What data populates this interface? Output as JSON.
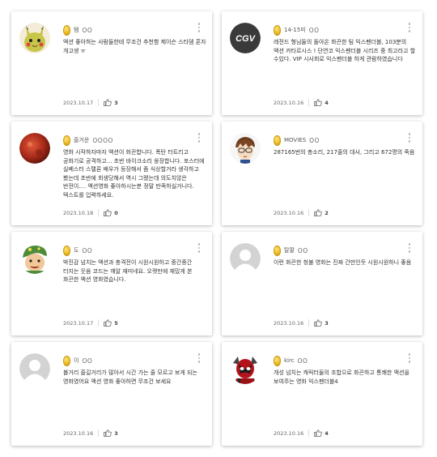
{
  "comments": [
    {
      "nickname": "탬",
      "masked": "OO",
      "text": "액션 좋아하는 사람들한테 무조건 추천함 제이슨 스타뎀 혼자 개고생 ㅠ",
      "date": "2023.10.17",
      "likes": "3",
      "avatar": "pikachu-avatar"
    },
    {
      "nickname": "14-15미",
      "masked": "OO",
      "text": "레전드 형님들의 돌아온 화끈한 팀 익스펜더블, 103분의 액션 카타르시스 ! 단연코 익스펜더블 시리즈 중 최고라고 할 수있다. VIP 시사회로 익스펜더블 하게 관람하였습니다",
      "date": "2023.10.16",
      "likes": "4",
      "avatar": "cgv-logo-avatar"
    },
    {
      "nickname": "즐거운",
      "masked": "OOOO",
      "text": "영화 시작하자마자 액션이 화끈합니다. 폭탄 터트리고 공화기로 공격하고... 초반 바이크소리 웅장합니다. 포스터에 실베스터 스탤론 배우가 등장해서 좀 식상할거라 생각하고 봤는데 초반에 회생당해서 역시 그랬는데 의도치않은 반전이.... 액션영화 좋아하시는분 정말 만족하실거니다.                    텍스트를 입력하세요.",
      "date": "2023.10.18",
      "likes": "0",
      "avatar": "red-sphere-avatar"
    },
    {
      "nickname": "MOVIES",
      "masked": "OO",
      "text": "287165번의 총소리, 217줄의 대사, 그리고 672명의 죽음",
      "date": "2023.10.16",
      "likes": "2",
      "avatar": "anime-character-avatar"
    },
    {
      "nickname": "도",
      "masked": "OO",
      "text": "박진감 넘치는 액션과 충격전이 시원시원하고 중간중간 터지는 웃음 코드는 깨알 재미네요. 오랫만에 재밌게 본 화끈한 액션 영화였습니다.",
      "date": "2023.10.17",
      "likes": "5",
      "avatar": "green-cap-character-avatar"
    },
    {
      "nickname": "탈팔",
      "masked": "OO",
      "text": "이런 화끈한 청불 영화는 진짜 간만인듯 시원시원하니 좋음",
      "date": "2023.10.16",
      "likes": "3",
      "avatar": "default-user-avatar"
    },
    {
      "nickname": "이",
      "masked": "OO",
      "text": "볼거리 즐길거리가 많아서 시간 가는 줄 모르고 보게 되는 영화였어요 액션 영화 좋아하면 무조건 보세요",
      "date": "2023.10.16",
      "likes": "3",
      "avatar": "default-user-avatar"
    },
    {
      "nickname": "kirc",
      "masked": "OO",
      "text": "개성 넘치는 캐릭터들의 조합으로 화끈하고 통쾌한 액션을 보여주는 영화 익스펜더블4",
      "date": "2023.10.16",
      "likes": "4",
      "avatar": "deadpool-avatar"
    }
  ],
  "colors": {
    "coin": "#e9b820",
    "text": "#333333",
    "muted": "#666666"
  },
  "icons": {
    "grade": "coin-icon",
    "menu": "more-dots-icon",
    "like": "thumbs-up-icon"
  }
}
